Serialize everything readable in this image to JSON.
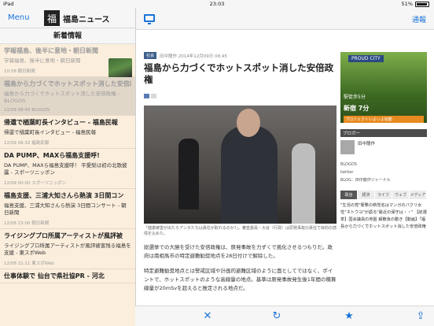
{
  "status_bar": {
    "carrier": "iPad",
    "time": "23:03",
    "battery": "51%"
  },
  "left_nav": {
    "menu_label": "Menu",
    "logo_glyph": "福",
    "app_title": "福島ニュース"
  },
  "left_header": "新着情報",
  "news_items": [
    {
      "headline": "学報福島、後半に意地・朝日新聞",
      "summary": "学報福島、後半に意地・朝日新聞",
      "meta": "10:58  朝日新聞",
      "state": "read",
      "thumb": true
    },
    {
      "headline": "福島から力づくでホットスポット消した安倍政権",
      "summary": "福島から力づくでホットスポット消した安倍政権 - BLOGOS",
      "meta": "12/09 08:45  BLOGOS",
      "state": "selected",
      "thumb": false
    },
    {
      "headline": "帰還で楢葉町長インタビュー - 福島民報",
      "summary": "帰還で楢葉町長インタビュー - 福島民報",
      "meta": "12/09 06:32  福島民報",
      "state": "unread",
      "thumb": false
    },
    {
      "headline": "DA PUMP、MAXら福島支援呼!",
      "summary": "DA PUMP、MAXら福島支援呼！ 平愛梨は初の北歌披露 - スポーツニッポン",
      "meta": "12/09 00:00  スポーツニッポン",
      "state": "unread",
      "thumb": false
    },
    {
      "headline": "福島支援、三浦大知さんら熱演 3日間コン",
      "summary": "福島支援、三浦大知さんら熱演 3日間コンサート - 朝日新聞",
      "meta": "12/08 23:00  朝日新聞",
      "state": "unread",
      "thumb": false
    },
    {
      "headline": "ライジングプロ所属アーティストが風評被",
      "summary": "ライジングプロ所属アーティストが風評被害残る福島を支援 - 東スポWeb",
      "meta": "12/08 21:11  東スポWeb",
      "state": "unread",
      "thumb": false
    },
    {
      "headline": "仕事体験で 仙台で県社協PR - 河北",
      "summary": "",
      "meta": "",
      "state": "unread",
      "thumb": false
    }
  ],
  "right_nav": {
    "normal_label": "通報"
  },
  "article": {
    "category_tag": "社会",
    "byline": "田中龍作  2014年12月09日 08:45",
    "title": "福島から力づくでホットスポット消した安倍政権",
    "caption": "「健康被害が出たらアンタたちは責任が取れるのか?」。審査委員・大谷（行政）は原発事故の責任で目的の感情を込めた。",
    "paragraph1": "総選挙での大勝を受けた安倍政権は、原発事故を力ずくで風化させるつもりだ。政府は南相馬市の特定避難勧奨地点を28日付けで解除した。",
    "paragraph2": "特定避難勧奨地点とは警戒区域や計画的避難区域のように面としてではなく、ポイントで、ホットスポットのような高線量の地点。基準は原発事故発生後1年間の積算線量が20mSvを超えると推定される地点だ。"
  },
  "sidebar": {
    "ad_brand": "PROUD CITY",
    "ad_line1": "駅徒歩5分",
    "ad_line2": "新宿 7分",
    "ad_line3": "プロジェクトいよいよ始動",
    "blogger_label": "ブロガー",
    "blogger_name": "田中龍作",
    "links": [
      "BLOGOS",
      "twitter",
      "BLOG：田中龍作ジャーナル"
    ],
    "tabs": [
      "政治",
      "経済",
      "ライフ",
      "ウェブ",
      "メディア"
    ],
    "rank_text": "\"生活の党\"衝撃の新党名はマンガのパクリ女性\"ネトウヨ\"が語る\"最近の保守は・・\" 【総選挙】国会議員の地盤 解散後の動き【動画】「福島から力づくでホットスポット消した安倍政権"
  },
  "toolbar": {
    "close": "✕",
    "reload": "↻",
    "star": "★",
    "share": "⇪"
  }
}
